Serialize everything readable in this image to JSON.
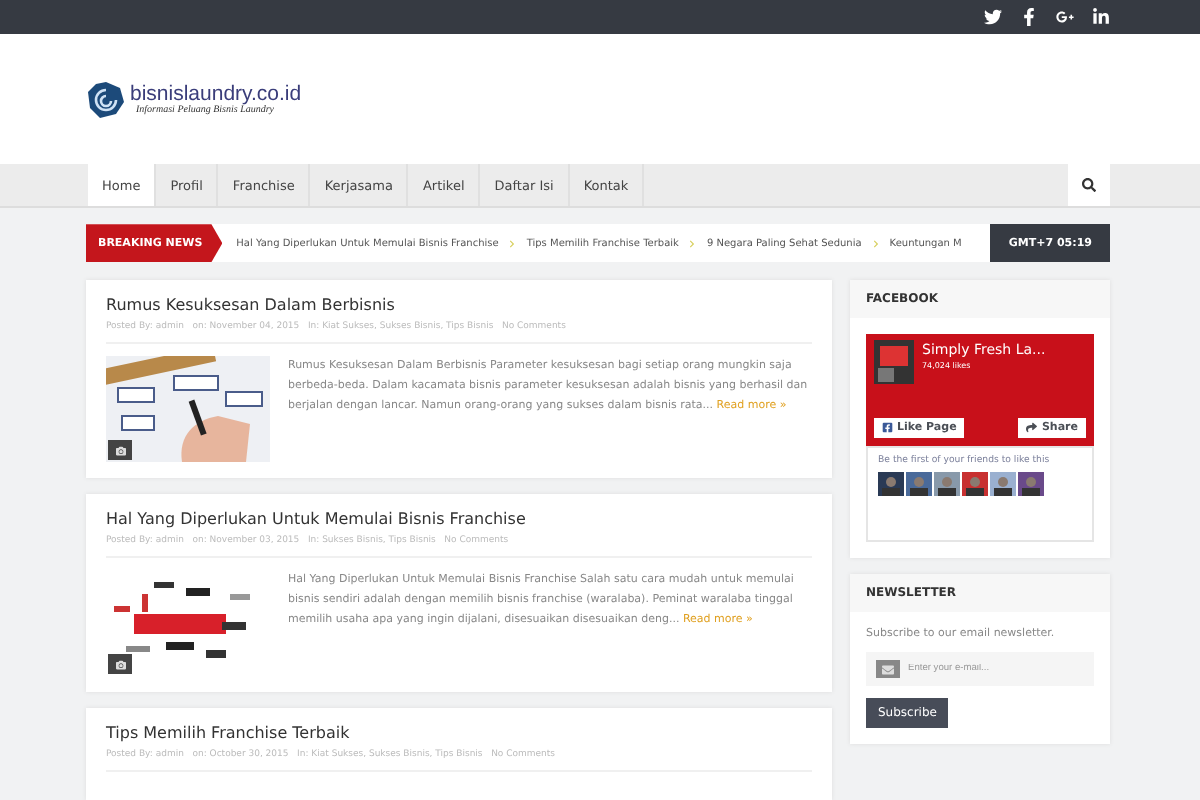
{
  "logo": {
    "name": "bisnislaundry.co.id",
    "tagline": "Informasi Peluang Bisnis Laundry"
  },
  "nav": [
    {
      "label": "Home",
      "selected": true
    },
    {
      "label": "Profil",
      "selected": false
    },
    {
      "label": "Franchise",
      "selected": false
    },
    {
      "label": "Kerjasama",
      "selected": false
    },
    {
      "label": "Artikel",
      "selected": false
    },
    {
      "label": "Daftar Isi",
      "selected": false
    },
    {
      "label": "Kontak",
      "selected": false
    }
  ],
  "breaking": {
    "label": "BREAKING NEWS",
    "items": [
      "Hal Yang Diperlukan Untuk Memulai Bisnis Franchise",
      "Tips Memilih Franchise Terbaik",
      "9 Negara Paling Sehat Sedunia",
      "Keuntungan M"
    ],
    "time": "GMT+7 05:19"
  },
  "posts": [
    {
      "title": "Rumus Kesuksesan Dalam Berbisnis",
      "meta": "Posted By: admin   on: November 04, 2015   In: Kiat Sukses, Sukses Bisnis, Tips Bisnis   No Comments",
      "excerpt": "Rumus Kesuksesan Dalam Berbisnis Parameter kesuksesan bagi setiap orang mungkin saja berbeda-beda. Dalam kacamata bisnis parameter kesuksesan adalah bisnis yang berhasil dan berjalan dengan lancar. Namun orang-orang yang sukses dalam bisnis rata...",
      "more": "Read more »"
    },
    {
      "title": "Hal Yang Diperlukan Untuk Memulai Bisnis Franchise",
      "meta": "Posted By: admin   on: November 03, 2015   In: Sukses Bisnis, Tips Bisnis   No Comments",
      "excerpt": "Hal Yang Diperlukan Untuk Memulai Bisnis Franchise Salah satu cara mudah untuk memulai bisnis sendiri adalah dengan memilih bisnis franchise (waralaba). Peminat waralaba tinggal memilih usaha apa yang ingin dijalani, disesuaikan disesuaikan deng...",
      "more": "Read more »"
    },
    {
      "title": "Tips Memilih Franchise Terbaik",
      "meta": "Posted By: admin   on: October 30, 2015   In: Kiat Sukses, Sukses Bisnis, Tips Bisnis   No Comments"
    }
  ],
  "facebook": {
    "heading": "FACEBOOK",
    "page": "Simply Fresh La...",
    "likes": "74,024 likes",
    "like": "Like Page",
    "share": "Share",
    "friends": "Be the first of your friends to like this"
  },
  "newsletter": {
    "heading": "NEWSLETTER",
    "text": "Subscribe to our email newsletter.",
    "placeholder": "Enter your e-mail...",
    "button": "Subscribe"
  }
}
